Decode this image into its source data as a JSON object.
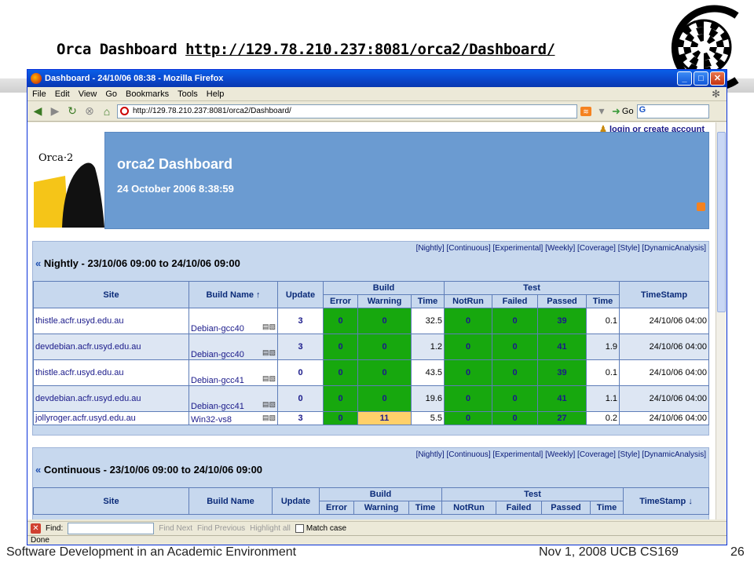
{
  "slide": {
    "title_prefix": "Orca Dashboard",
    "title_url": "http://129.78.210.237:8081/orca2/Dashboard/",
    "footer_left": "Software Development in an Academic Environment",
    "footer_right": "Nov 1, 2008 UCB CS169",
    "page_number": "26"
  },
  "browser": {
    "window_title": "Dashboard - 24/10/06 08:38 - Mozilla Firefox",
    "menu": [
      "File",
      "Edit",
      "View",
      "Go",
      "Bookmarks",
      "Tools",
      "Help"
    ],
    "url": "http://129.78.210.237:8081/orca2/Dashboard/",
    "go_label": "Go",
    "find": {
      "label": "Find:",
      "value": "",
      "next": "Find Next",
      "previous": "Find Previous",
      "highlight": "Highlight all",
      "match_case": "Match case"
    },
    "status": "Done"
  },
  "page": {
    "login": "login or create account",
    "logo_text": "Orca·2",
    "dashboard_title": "orca2 Dashboard",
    "dashboard_date": "24 October 2006 8:38:59",
    "nav_links": "[Nightly] [Continuous] [Experimental] [Weekly] [Coverage] [Style] [DynamicAnalysis]"
  },
  "columns": {
    "site": "Site",
    "build_name": "Build Name",
    "update": "Update",
    "build": "Build",
    "test": "Test",
    "timestamp": "TimeStamp",
    "error": "Error",
    "warning": "Warning",
    "time": "Time",
    "notrun": "NotRun",
    "failed": "Failed",
    "passed": "Passed",
    "sort_up": "↑",
    "sort_down": "↓"
  },
  "nightly": {
    "title": "Nightly - 23/10/06 09:00 to 24/10/06 09:00",
    "rows": [
      {
        "site": "thistle.acfr.usyd.edu.au",
        "build": "Debian-gcc40",
        "update": "3",
        "error": "0",
        "warning": "0",
        "btime": "32.5",
        "notrun": "0",
        "failed": "0",
        "passed": "39",
        "ttime": "0.1",
        "stamp": "24/10/06 04:00"
      },
      {
        "site": "devdebian.acfr.usyd.edu.au",
        "build": "Debian-gcc40",
        "update": "3",
        "error": "0",
        "warning": "0",
        "btime": "1.2",
        "notrun": "0",
        "failed": "0",
        "passed": "41",
        "ttime": "1.9",
        "stamp": "24/10/06 04:00"
      },
      {
        "site": "thistle.acfr.usyd.edu.au",
        "build": "Debian-gcc41",
        "update": "0",
        "error": "0",
        "warning": "0",
        "btime": "43.5",
        "notrun": "0",
        "failed": "0",
        "passed": "39",
        "ttime": "0.1",
        "stamp": "24/10/06 04:00"
      },
      {
        "site": "devdebian.acfr.usyd.edu.au",
        "build": "Debian-gcc41",
        "update": "0",
        "error": "0",
        "warning": "0",
        "btime": "19.6",
        "notrun": "0",
        "failed": "0",
        "passed": "41",
        "ttime": "1.1",
        "stamp": "24/10/06 04:00"
      },
      {
        "site": "jollyroger.acfr.usyd.edu.au",
        "build": "Win32-vs8",
        "update": "3",
        "error": "0",
        "warning": "11",
        "btime": "5.5",
        "notrun": "0",
        "failed": "0",
        "passed": "27",
        "ttime": "0.2",
        "stamp": "24/10/06 04:00"
      }
    ]
  },
  "continuous": {
    "title": "Continuous - 23/10/06 09:00 to 24/10/06 09:00"
  },
  "colors": {
    "pass_green": "#17a80e",
    "warn_orange": "#ffd06a",
    "banner_blue": "#6b9bd1",
    "header_blue": "#c7d8ee"
  }
}
